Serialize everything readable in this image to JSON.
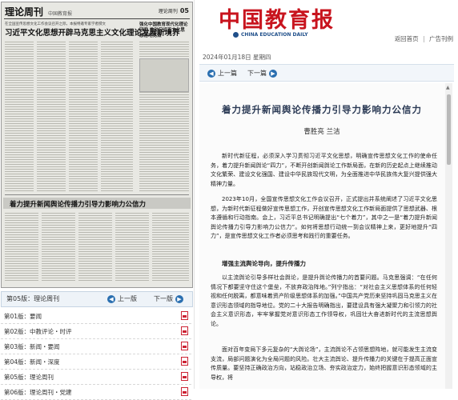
{
  "newspaper": {
    "masthead": "理论周刊",
    "masthead_sub": "中国教育报",
    "page_code": "05",
    "page_name": "理论周刊",
    "kicker": "在全国宣传思想文化工作会议召开之际，本报特邀专家学者撰文",
    "lead_headline": "习近平文化思想开辟马克思主义文化理论发展新境界",
    "side_headline": "强化中国教育现代化理论研究 推动习近平文化思想落地见效",
    "second_headline": "着力提升新闻舆论传播力引导力影响力公信力"
  },
  "page_bar": {
    "current": "第05版：理论周刊",
    "prev_label": "上一版",
    "next_label": "下一版"
  },
  "page_list": [
    {
      "label": "第01版：要闻"
    },
    {
      "label": "第02版：中教评论・时评"
    },
    {
      "label": "第03版：新闻・要闻"
    },
    {
      "label": "第04版：新闻・深度"
    },
    {
      "label": "第05版：理论周刊"
    },
    {
      "label": "第06版：理论周刊・党建"
    }
  ],
  "header": {
    "logo_cn": "中国教育报",
    "logo_en": "CHINA EDUCATION DAILY",
    "link_home": "返回首页",
    "link_separator": "|",
    "link_ads": "广告刊例",
    "date": "2024年01月18日  星期四"
  },
  "article_nav": {
    "prev_label": "上一篇",
    "next_label": "下一篇"
  },
  "article": {
    "title": "着力提升新闻舆论传播力引导力影响力公信力",
    "authors": "曹胜亮  兰洁",
    "paragraphs": [
      "新时代新征程，必须深入学习贯彻习近平文化思想，明确宣传思想文化工作的使命任务，着力提升新闻舆论“四力”，不断开创新闻舆论工作新局面，在新的历史起点上继续推动文化繁荣、建设文化强国、建设中华民族现代文明，为全面推进中华民族伟大复兴提供强大精神力量。",
      "2023年10月，全国宣传思想文化工作会议召开，正式提出并系统阐述了习近平文化思想，为新时代新征程做好宣传思想工作，开创宣传思想文化工作新局面提供了思想武器、根本遵循和行动指南。会上，习近平总书记明确提出“七个着力”，其中之一是“着力提升新闻舆论传播力引导力影响力公信力”。如何将思想行动统一到会议精神上来，更好地提升“四力”，是宣传思想文化工作者必须思考和践行的重要任务。"
    ],
    "subhead": "增强主流舆论导向，提升传播力",
    "paragraphs_2": [
      "以主流舆论引导多样社会舆论，是提升舆论传播力的首要问题。马克思强调：“在任何情况下都要坚守住这个堡垒，不放弃政治阵地。”列宁指出：“对社会主义思想体系的任何轻视和任何脱离，都意味着资产阶级思想体系的加强。”中国共产党历来坚持巩固马克思主义在意识形态领域的指导地位。党的二十大报告明确指出，要建设具有强大凝聚力和引领力的社会主义意识形态，牢牢掌握党对意识形态工作领导权，巩固壮大奋进新时代的主流思想舆论。",
      "面对百年变局下多元复杂的“大舆论场”，主流舆论不占领思想阵地，就可能发生主流变支流，局部问题演化为全局问题的风险。壮大主流舆论、提升传播力的关键在于提高正面宣传质量。要坚持正确政治方向，站稳政治立场、夯实政治定力，始终把握意识形态领域的主导权，将"
    ]
  },
  "colors": {
    "brand_red": "#c8141e",
    "brand_blue": "#1f4f8a",
    "title_navy": "#2b3a55",
    "nav_circle": "#2a6fb0"
  },
  "icons": {
    "prev": "left-arrow-circle-icon",
    "next": "right-arrow-circle-icon",
    "pdf": "pdf-icon",
    "scroll_up": "scroll-up-arrow-icon"
  }
}
